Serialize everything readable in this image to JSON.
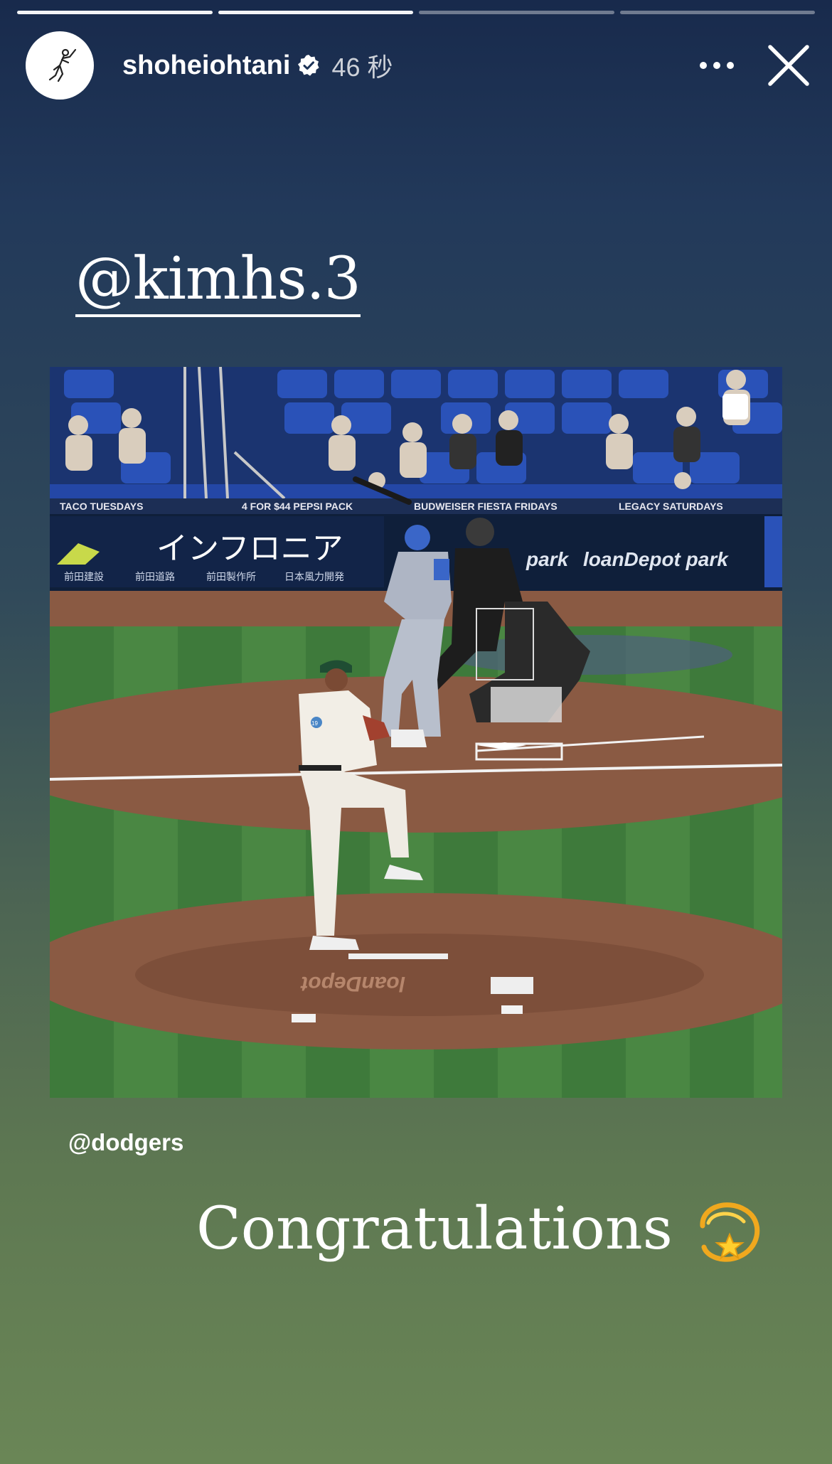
{
  "progress": {
    "segments": 4,
    "active_index": 2
  },
  "header": {
    "username": "shoheiohtani",
    "time": "46 秒",
    "more_icon": "more-horizontal-icon",
    "close_icon": "close-icon"
  },
  "sticker_mention": "@kimhs.3",
  "media": {
    "banner": {
      "taco": "TACO TUESDAYS",
      "pepsi": "4 FOR $44 PEPSI PACK",
      "fiesta": "BUDWEISER FIESTA FRIDAYS",
      "legacy": "LEGACY SATURDAYS"
    },
    "sign_left": "インフロニア",
    "sign_sub1": "前田建設",
    "sign_sub2": "前田道路",
    "sign_sub3": "前田製作所",
    "sign_sub4": "日本風力開発",
    "sign_park_partial": "park",
    "sign_right": "loanDepot park",
    "mound_text": "loanDepot",
    "pitcher_number": "19"
  },
  "credit": "@dodgers",
  "caption": {
    "text": "Congratulations",
    "emoji": "dizzy-star-emoji"
  },
  "colors": {
    "bg_top": "#182a4c",
    "bg_bottom": "#6a8656",
    "seat_blue": "#2a52b8",
    "grass": "#3f7a3c",
    "dirt": "#8a5a43"
  }
}
